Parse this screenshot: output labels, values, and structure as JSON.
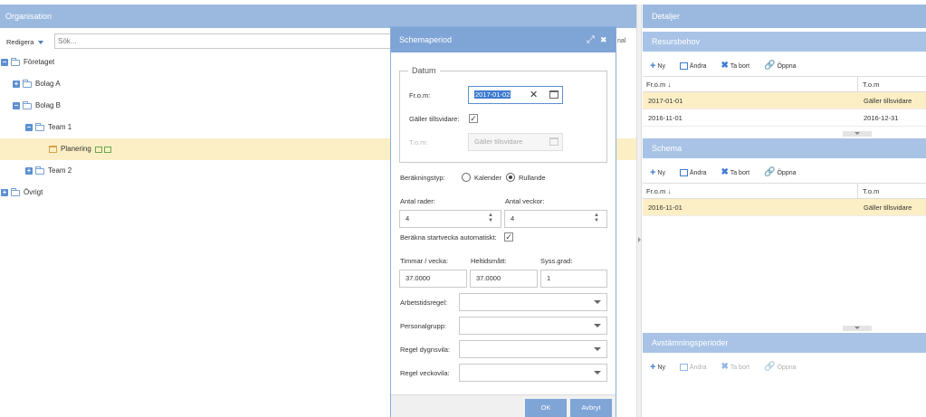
{
  "organisation": {
    "title": "Organisation",
    "edit_label": "Redigera",
    "search_placeholder": "Sök...",
    "truncated_text": "nal",
    "tree": [
      {
        "label": "Företaget",
        "expander": "−",
        "indent": 0,
        "open": true
      },
      {
        "label": "Bolag A",
        "expander": "+",
        "indent": 1
      },
      {
        "label": "Bolag B",
        "expander": "−",
        "indent": 1,
        "open": true
      },
      {
        "label": "Team 1",
        "expander": "−",
        "indent": 2,
        "open": true
      },
      {
        "label": "Planering",
        "indent": 3,
        "selected": true
      },
      {
        "label": "Team 2",
        "expander": "+",
        "indent": 2
      },
      {
        "label": "Övrigt",
        "expander": "+",
        "indent": 0
      }
    ]
  },
  "modal": {
    "title": "Schemaperiod",
    "datum_legend": "Datum",
    "from_label": "Fr.o.m:",
    "from_value": "2017-01-02",
    "until_further_label": "Gäller tillsvidare:",
    "until_further_checked": true,
    "tom_label": "T.o.m:",
    "tom_placeholder": "Gäller tillsvidare",
    "calc_type_label": "Beräkningstyp:",
    "calc_option_calendar": "Kalender",
    "calc_option_rolling": "Rullande",
    "rows_label": "Antal rader:",
    "rows_value": "4",
    "weeks_label": "Antal veckor:",
    "weeks_value": "4",
    "auto_start_label": "Beräkna startvecka automatiskt:",
    "auto_start_checked": true,
    "hours_label": "Timmar / vecka:",
    "hours_value": "37.0000",
    "fulltime_label": "Heltidsmått:",
    "fulltime_value": "37.0000",
    "employment_label": "Syss.grad:",
    "employment_value": "1",
    "work_rule_label": "Arbetstidsregel:",
    "staff_group_label": "Personalgrupp:",
    "daily_rest_label": "Regel dygnsvila:",
    "weekly_rest_label": "Regel veckovila:",
    "ok_label": "OK",
    "cancel_label": "Avbryt",
    "expand_glyph": "⤢",
    "close_glyph": "✖"
  },
  "details": {
    "title": "Detaljer",
    "toolbar": {
      "new": "Ny",
      "edit": "Ändra",
      "delete": "Ta bort",
      "open": "Öppna"
    },
    "resursbehov": {
      "title": "Resursbehov",
      "col_from": "Fr.o.m",
      "col_to": "T.o.m",
      "rows": [
        {
          "from": "2017-01-01",
          "to": "Gäller tillsvidare",
          "selected": true
        },
        {
          "from": "2016-11-01",
          "to": "2016-12-31"
        }
      ]
    },
    "schema": {
      "title": "Schema",
      "col_from": "Fr.o.m",
      "col_to": "T.o.m",
      "rows": [
        {
          "from": "2016-11-01",
          "to": "Gäller tillsvidare",
          "selected": true
        }
      ]
    },
    "avstamning": {
      "title": "Avstämningsperioder"
    }
  },
  "colors": {
    "header": "#9bb9df",
    "modal_header": "#7fa4d6",
    "selected_row": "#fcefc5",
    "accent": "#3d7bd0"
  }
}
